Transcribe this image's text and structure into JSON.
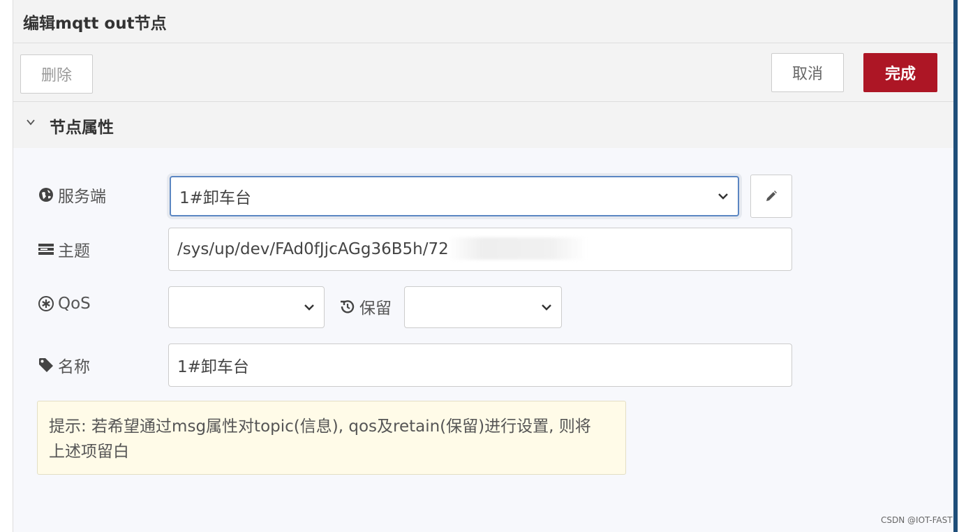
{
  "dialog": {
    "title": "编辑mqtt out节点"
  },
  "toolbar": {
    "delete_label": "删除",
    "cancel_label": "取消",
    "done_label": "完成"
  },
  "section": {
    "label": "节点属性"
  },
  "fields": {
    "server": {
      "label": "服务端",
      "value": "1#卸车台",
      "icon": "globe-icon"
    },
    "topic": {
      "label": "主题",
      "value": "/sys/up/dev/FAd0fJjcAGg36B5h/72",
      "icon": "topic-icon"
    },
    "qos": {
      "label": "QoS",
      "value": "",
      "icon": "qos-icon"
    },
    "retain": {
      "label": "保留",
      "value": "",
      "icon": "history-icon"
    },
    "name": {
      "label": "名称",
      "value": "1#卸车台",
      "icon": "tag-icon"
    }
  },
  "tip": {
    "line1": "提示: 若希望通过msg属性对topic(信息), qos及retain(保留)进行设置, 则将",
    "line2": "上述项留白"
  },
  "watermark": "CSDN @IOT-FAST",
  "colors": {
    "done_button": "#ad1625",
    "focus_border": "#5b86c2",
    "tip_background": "#fffbe8",
    "right_stripe": "#1f4e79"
  }
}
